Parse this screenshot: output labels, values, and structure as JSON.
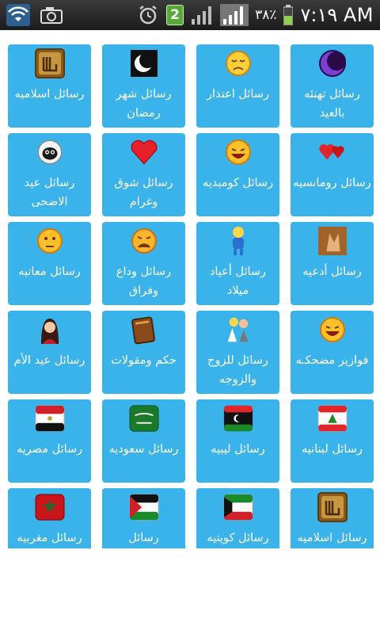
{
  "statusbar": {
    "battery_percent": "٣٨٪",
    "badge_number": "2",
    "time": "٧:١٩ AM",
    "icons": [
      "wifi-icon",
      "camera-icon",
      "alarm-icon",
      "notification-badge",
      "signal-icon",
      "signal-icon",
      "battery-icon"
    ]
  },
  "tiles": [
    {
      "label": "رسائل تهنئه بالعيد",
      "icon": "crescent-moon-purple-icon"
    },
    {
      "label": "رسائل اعتذار",
      "icon": "sad-smiley-icon"
    },
    {
      "label": "رسائل شهر رمضان",
      "icon": "crescent-moon-night-icon"
    },
    {
      "label": "رسائل اسلاميه",
      "icon": "allah-calligraphy-icon"
    },
    {
      "label": "رسائل رومانسيه",
      "icon": "red-hearts-icon"
    },
    {
      "label": "رسائل كوميديه",
      "icon": "laughing-smiley-icon"
    },
    {
      "label": "رسائل شوق وغرام",
      "icon": "red-heart-icon"
    },
    {
      "label": "رسائل عيد الاضحى",
      "icon": "sheep-icon"
    },
    {
      "label": "رسائل أدعيه",
      "icon": "praying-hands-icon"
    },
    {
      "label": "رسائل أعياد ميلاد",
      "icon": "cartoon-character-icon"
    },
    {
      "label": "رسائل وداع وفراق",
      "icon": "crying-smiley-icon"
    },
    {
      "label": "رسائل معاتبه",
      "icon": "pouting-smiley-icon"
    },
    {
      "label": "فوازير مضحكـه",
      "icon": "laughing-smiley-icon"
    },
    {
      "label": "رسائل للزوج والزوجه",
      "icon": "couple-icon"
    },
    {
      "label": "حكم ومقولات",
      "icon": "book-icon"
    },
    {
      "label": "رسائل عيد الأم",
      "icon": "mother-icon"
    },
    {
      "label": "رسائل لبنانيه",
      "icon": "lebanon-flag-icon"
    },
    {
      "label": "رسائل ليبيه",
      "icon": "libya-flag-icon"
    },
    {
      "label": "رسائل سعوديه",
      "icon": "saudi-flag-icon"
    },
    {
      "label": "رسائل مصريه",
      "icon": "egypt-flag-icon"
    },
    {
      "label": "رسائل اسلاميه",
      "icon": "allah-calligraphy-icon"
    },
    {
      "label": "رسائل كويتيه",
      "icon": "kuwait-flag-icon"
    },
    {
      "label": "رسائل",
      "icon": "palestine-flag-icon"
    },
    {
      "label": "رسائل مغربيه",
      "icon": "morocco-flag-icon"
    }
  ]
}
